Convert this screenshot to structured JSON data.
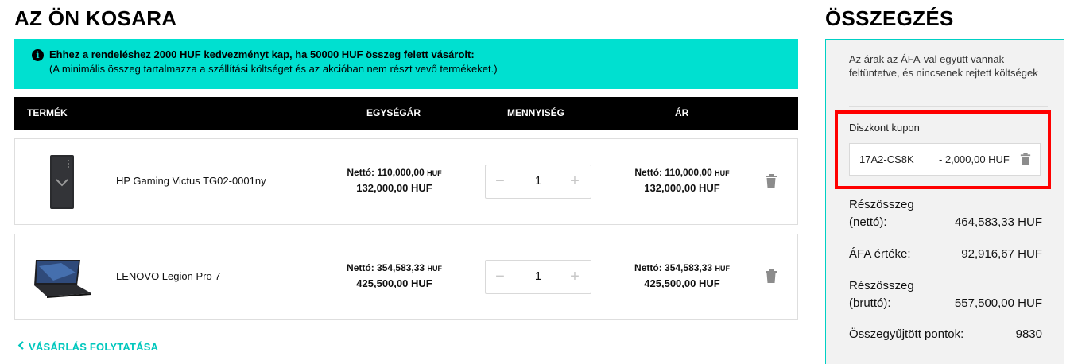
{
  "cart": {
    "title": "AZ ÖN KOSARA",
    "banner": {
      "line1": "Ehhez a rendeléshez 2000 HUF kedvezményt kap, ha 50000 HUF összeg felett vásárolt:",
      "line2": "(A minimális összeg tartalmazza a szállítási költséget és az akcióban nem részt vevő termékeket.)",
      "icon": "info-icon"
    },
    "columns": {
      "product": "TERMÉK",
      "unit_price": "EGYSÉGÁR",
      "quantity": "MENNYISÉG",
      "price": "ÁR"
    },
    "items": [
      {
        "name": "HP Gaming Victus TG02-0001ny",
        "unit_net_label": "Nettó: 110,000,00",
        "unit_gross": "132,000,00 HUF",
        "quantity": "1",
        "total_net_label": "Nettó: 110,000,00",
        "total_gross": "132,000,00 HUF",
        "image": "desktop-pc-tower"
      },
      {
        "name": "LENOVO Legion Pro 7",
        "unit_net_label": "Nettó: 354,583,33",
        "unit_gross": "425,500,00 HUF",
        "quantity": "1",
        "total_net_label": "Nettó: 354,583,33",
        "total_gross": "425,500,00 HUF",
        "image": "gaming-laptop"
      }
    ],
    "currency_small": "HUF",
    "qty_minus": "−",
    "qty_plus": "+",
    "continue_label": "VÁSÁRLÁS FOLYTATÁSA",
    "continue_icon": "chevron-left-icon"
  },
  "summary": {
    "title": "ÖSSZEGZÉS",
    "note": "Az árak az ÁFA-val együtt vannak feltüntetve, és nincsenek rejtett költségek",
    "coupon": {
      "label": "Diszkont kupon",
      "code": "17A2-CS8K",
      "amount": "- 2,000,00 HUF",
      "highlight_color": "#ff0000"
    },
    "rows": [
      {
        "label": "Részösszeg (nettó):",
        "value": "464,583,33 HUF"
      },
      {
        "label": "ÁFA értéke:",
        "value": "92,916,67 HUF"
      },
      {
        "label": "Részösszeg (bruttó):",
        "value": "557,500,00 HUF"
      },
      {
        "label": "Összegyűjtött pontok:",
        "value": "9830"
      }
    ]
  },
  "colors": {
    "accent": "#00e0d0",
    "link": "#00c7bd",
    "header_bg": "#000000"
  }
}
